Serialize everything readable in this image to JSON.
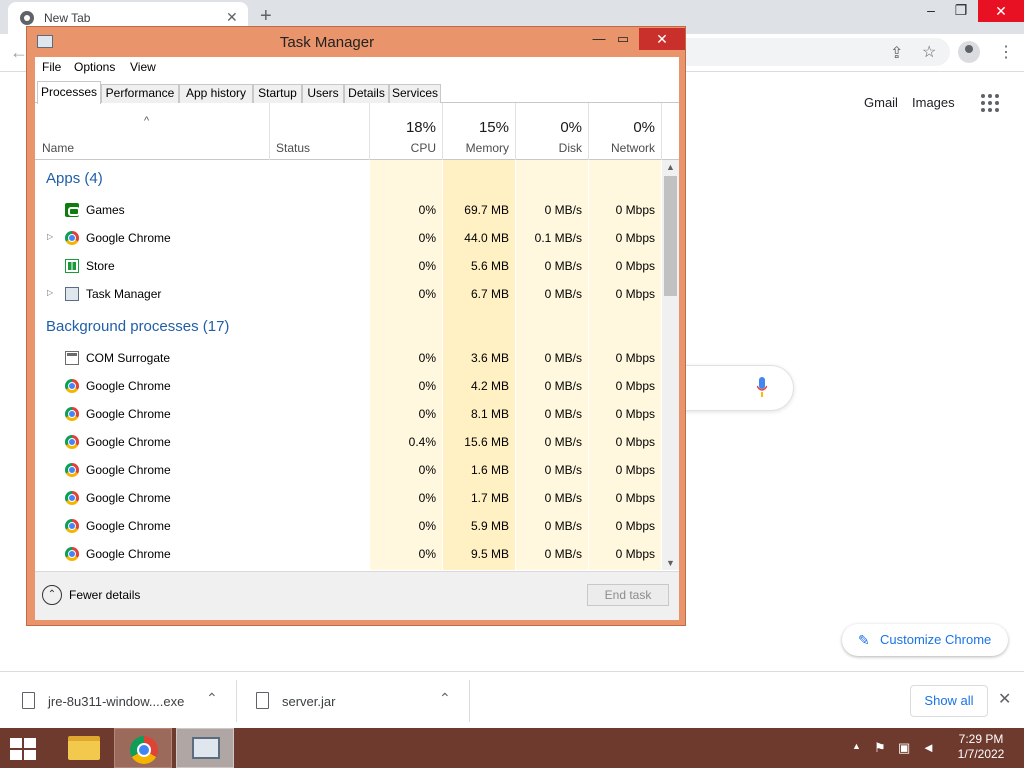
{
  "browser": {
    "tab_title": "New Tab",
    "new_tab_symbol": "+",
    "minimize_symbol": "–",
    "restore_symbol": "❐",
    "close_symbol": "✕",
    "tab_close_symbol": "✕",
    "gmail": "Gmail",
    "images": "Images",
    "customize_chrome": "Customize Chrome",
    "icons": [
      "chrome-favicon",
      "share-icon",
      "star-icon",
      "profile-icon",
      "menu-dots-icon",
      "apps-grid-icon",
      "mic-icon",
      "pencil-icon"
    ]
  },
  "downloads": {
    "items": [
      {
        "name": "jre-8u311-window....exe"
      },
      {
        "name": "server.jar"
      }
    ],
    "show_all": "Show all",
    "close_symbol": "✕"
  },
  "taskbar": {
    "time": "7:29 PM",
    "date": "1/7/2022",
    "bg_color": "#6e3a2e"
  },
  "task_manager": {
    "title": "Task Manager",
    "window_color": "#e9946a",
    "menu": [
      "File",
      "Options",
      "View"
    ],
    "tabs": [
      "Processes",
      "Performance",
      "App history",
      "Startup",
      "Users",
      "Details",
      "Services"
    ],
    "active_tab": "Processes",
    "sort_indicator": "^",
    "columns": {
      "name": "Name",
      "status": "Status",
      "cpu": {
        "pct": "18%",
        "label": "CPU"
      },
      "memory": {
        "pct": "15%",
        "label": "Memory"
      },
      "disk": {
        "pct": "0%",
        "label": "Disk"
      },
      "network": {
        "pct": "0%",
        "label": "Network"
      }
    },
    "groups": {
      "apps": {
        "title": "Apps (4)",
        "rows": [
          {
            "name": "Games",
            "icon": "games-icon",
            "expandable": false,
            "cpu": "0%",
            "memory": "69.7 MB",
            "disk": "0 MB/s",
            "network": "0 Mbps"
          },
          {
            "name": "Google Chrome",
            "icon": "chrome-icon",
            "expandable": true,
            "cpu": "0%",
            "memory": "44.0 MB",
            "disk": "0.1 MB/s",
            "network": "0 Mbps"
          },
          {
            "name": "Store",
            "icon": "store-icon",
            "expandable": false,
            "cpu": "0%",
            "memory": "5.6 MB",
            "disk": "0 MB/s",
            "network": "0 Mbps"
          },
          {
            "name": "Task Manager",
            "icon": "task-manager-icon",
            "expandable": true,
            "cpu": "0%",
            "memory": "6.7 MB",
            "disk": "0 MB/s",
            "network": "0 Mbps"
          }
        ]
      },
      "background": {
        "title": "Background processes (17)",
        "rows": [
          {
            "name": "COM Surrogate",
            "icon": "com-surrogate-icon",
            "expandable": false,
            "cpu": "0%",
            "memory": "3.6 MB",
            "disk": "0 MB/s",
            "network": "0 Mbps"
          },
          {
            "name": "Google Chrome",
            "icon": "chrome-icon",
            "expandable": false,
            "cpu": "0%",
            "memory": "4.2 MB",
            "disk": "0 MB/s",
            "network": "0 Mbps"
          },
          {
            "name": "Google Chrome",
            "icon": "chrome-icon",
            "expandable": false,
            "cpu": "0%",
            "memory": "8.1 MB",
            "disk": "0 MB/s",
            "network": "0 Mbps"
          },
          {
            "name": "Google Chrome",
            "icon": "chrome-icon",
            "expandable": false,
            "cpu": "0.4%",
            "memory": "15.6 MB",
            "disk": "0 MB/s",
            "network": "0 Mbps"
          },
          {
            "name": "Google Chrome",
            "icon": "chrome-icon",
            "expandable": false,
            "cpu": "0%",
            "memory": "1.6 MB",
            "disk": "0 MB/s",
            "network": "0 Mbps"
          },
          {
            "name": "Google Chrome",
            "icon": "chrome-icon",
            "expandable": false,
            "cpu": "0%",
            "memory": "1.7 MB",
            "disk": "0 MB/s",
            "network": "0 Mbps"
          },
          {
            "name": "Google Chrome",
            "icon": "chrome-icon",
            "expandable": false,
            "cpu": "0%",
            "memory": "5.9 MB",
            "disk": "0 MB/s",
            "network": "0 Mbps"
          },
          {
            "name": "Google Chrome",
            "icon": "chrome-icon",
            "expandable": false,
            "cpu": "0%",
            "memory": "9.5 MB",
            "disk": "0 MB/s",
            "network": "0 Mbps"
          }
        ]
      }
    },
    "footer": {
      "fewer_details": "Fewer details",
      "end_task": "End task"
    }
  }
}
